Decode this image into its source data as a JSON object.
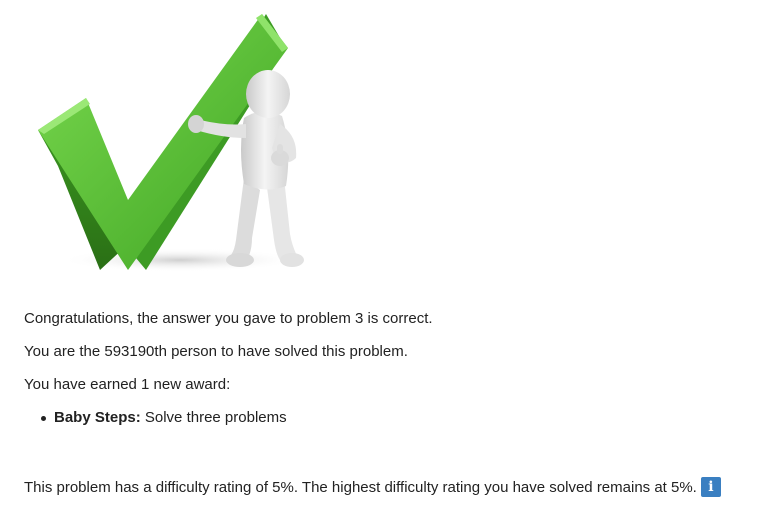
{
  "hero": {
    "image": "green-checkmark-with-figure",
    "colors": {
      "check_light": "#66cc44",
      "check_mid": "#4cb52c",
      "check_dark": "#2e7d1a",
      "figure": "#e8e8e8"
    }
  },
  "messages": {
    "correct": "Congratulations, the answer you gave to problem 3 is correct.",
    "solver_rank": "You are the 593190th person to have solved this problem.",
    "awards_intro": "You have earned 1 new award:"
  },
  "awards": [
    {
      "name": "Baby Steps:",
      "description": "Solve three problems"
    }
  ],
  "difficulty": {
    "text": "This problem has a difficulty rating of 5%. The highest difficulty rating you have solved remains at 5%.",
    "info_icon_glyph": "i",
    "info_icon_color": "#3a7fc1"
  }
}
